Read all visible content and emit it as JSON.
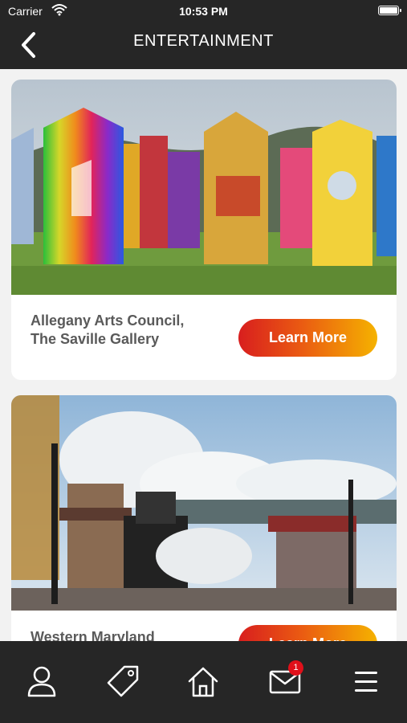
{
  "status_bar": {
    "carrier": "Carrier",
    "time": "10:53 PM"
  },
  "nav": {
    "title": "ENTERTAINMENT",
    "back_icon": "chevron-left-icon"
  },
  "cards": [
    {
      "name": "Allegany Arts Council, The Saville Gallery",
      "button_label": "Learn More",
      "image": "colorful-art-panels-installation"
    },
    {
      "name": "Western Maryland",
      "button_label": "Learn More",
      "image": "steam-train-station"
    }
  ],
  "tabbar": {
    "items": [
      {
        "icon": "user-icon"
      },
      {
        "icon": "tag-icon"
      },
      {
        "icon": "home-icon"
      },
      {
        "icon": "mail-icon",
        "badge": "1"
      },
      {
        "icon": "menu-icon"
      }
    ]
  },
  "colors": {
    "bar_bg": "#262626",
    "button_start": "#d81e1e",
    "button_end": "#f5b200",
    "badge": "#e0101a"
  }
}
